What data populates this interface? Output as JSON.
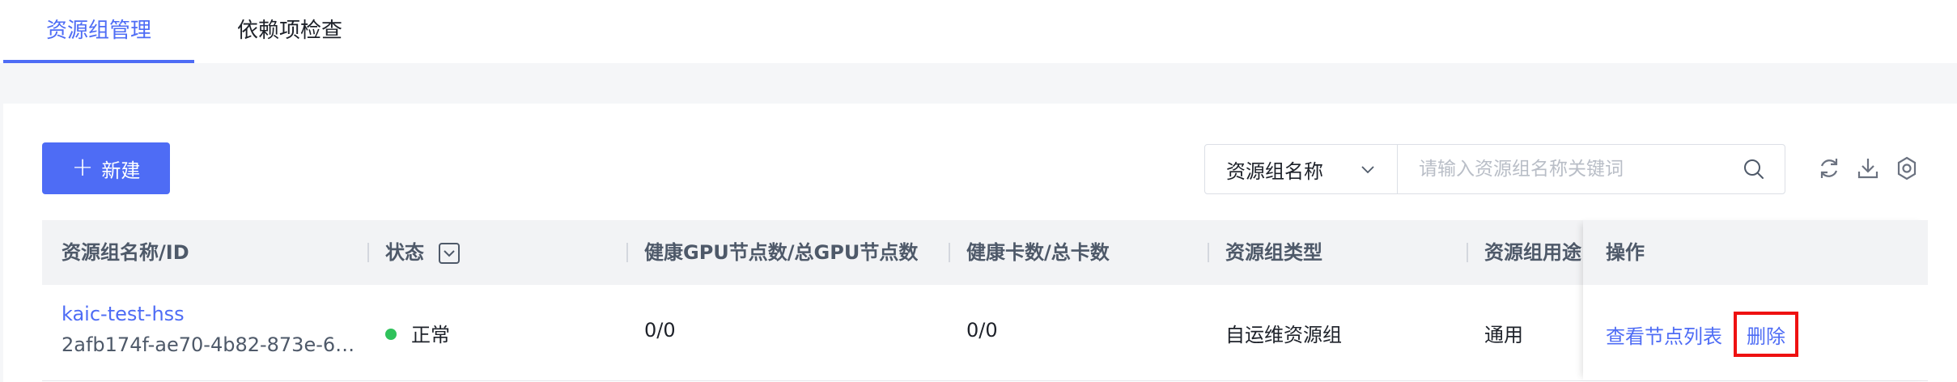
{
  "tabs": [
    {
      "label": "资源组管理",
      "active": true
    },
    {
      "label": "依赖项检查",
      "active": false
    }
  ],
  "toolbar": {
    "new_label": "新建",
    "search_field_label": "资源组名称",
    "search_placeholder": "请输入资源组名称关键词",
    "icons": [
      "refresh-icon",
      "download-icon",
      "settings-icon"
    ]
  },
  "table": {
    "headers": {
      "name": "资源组名称/ID",
      "status": "状态",
      "healthy_gpu_nodes": "健康GPU节点数/总GPU节点数",
      "healthy_cards": "健康卡数/总卡数",
      "type": "资源组类型",
      "usage": "资源组用途",
      "actions": "操作"
    },
    "rows": [
      {
        "name": "kaic-test-hss",
        "id": "2afb174f-ae70-4b82-873e-6…",
        "status": "正常",
        "healthy_gpu_nodes": "0/0",
        "healthy_cards": "0/0",
        "type": "自运维资源组",
        "usage": "通用",
        "action_view": "查看节点列表",
        "action_delete": "删除"
      }
    ]
  },
  "colors": {
    "primary": "#4e6cf5",
    "status_ok": "#2fc25b",
    "highlight_box": "#ee1111"
  }
}
